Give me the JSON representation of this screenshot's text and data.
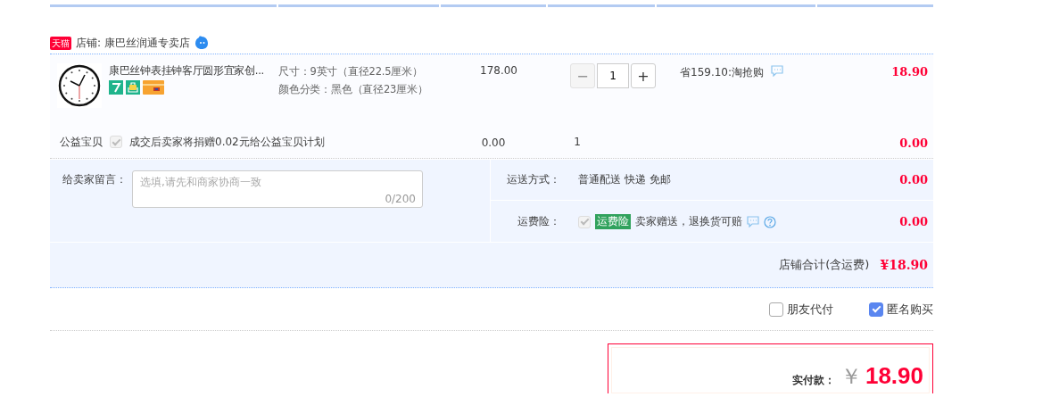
{
  "shop": {
    "badge": "天猫",
    "label": "店铺: 康巴丝润通专卖店"
  },
  "item": {
    "title": "康巴丝钟表挂钟客厅圆形宜家创...",
    "sku": [
      "尺寸：9英寸（直径22.5厘米）",
      "颜色分类：黑色（直径23厘米）"
    ],
    "price": "178.00",
    "quantity": {
      "minus": "−",
      "value": "1",
      "plus": "+",
      "minus_disabled": true
    },
    "promo": "省159.10:淘抢购",
    "amount": "18.90"
  },
  "charity": {
    "label": "公益宝贝",
    "checked": true,
    "disabled": true,
    "text": "成交后卖家将捐赠0.02元给公益宝贝计划",
    "price": "0.00",
    "quantity": "1",
    "amount": "0.00"
  },
  "memo": {
    "label": "给卖家留言：",
    "placeholder": "选填,请先和商家协商一致",
    "counter": "0/200"
  },
  "shipping": {
    "label": "运送方式：",
    "value": "普通配送 快递 免邮",
    "amount": "0.00"
  },
  "insurance": {
    "label": "运费险：",
    "checked": true,
    "disabled": true,
    "tag": "运费险",
    "text": "卖家赠送，退换货可赔",
    "amount": "0.00"
  },
  "shop_total": {
    "label": "店铺合计(含运费)",
    "amount": "¥18.90"
  },
  "options": [
    {
      "label": "朋友代付",
      "checked": false
    },
    {
      "label": "匿名购买",
      "checked": true
    }
  ],
  "payment": {
    "label": "实付款：",
    "currency": "￥",
    "amount": "18.90"
  }
}
